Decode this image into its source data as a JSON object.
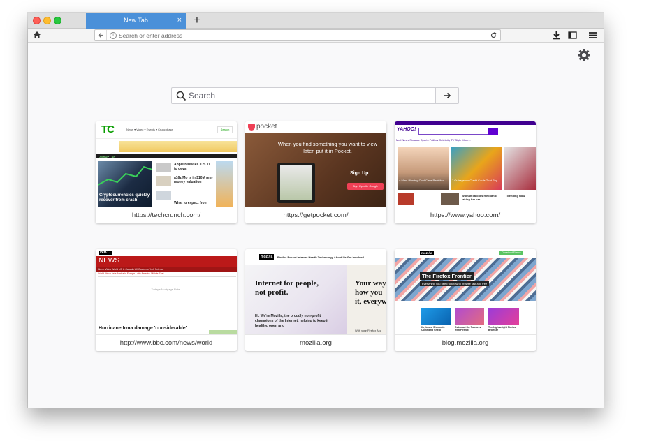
{
  "window": {
    "tab_title": "New Tab",
    "tab_close": "×",
    "new_tab": "+"
  },
  "navbar": {
    "url_placeholder": "Search or enter address"
  },
  "search": {
    "placeholder": "Search"
  },
  "tiles": [
    {
      "label": "https://techcrunch.com/",
      "thumb": {
        "logo": "TC",
        "nav": "News ▾   Video ▾   Events ▾   Crunchbase",
        "search_btn": "Search",
        "banner": "DISRUPT SF",
        "headline1": "Apple releases iOS 11 to devs",
        "headline2": "a16z/Mo Is in $10M pre-money valuation",
        "main_headline": "Cryptocurrencies quickly recover from crash",
        "headline3": "What to expect from"
      }
    },
    {
      "label": "https://getpocket.com/",
      "thumb": {
        "logo": "pocket",
        "headline": "When you find something you want to view later, put it in Pocket.",
        "signup": "Sign Up",
        "google_btn": "Sign Up with Google"
      }
    },
    {
      "label": "https://www.yahoo.com/",
      "thumb": {
        "logo": "YAHOO!",
        "nav": "Mail   News   Finance   Sports   Politics   Celebrity   TV   Style   More...",
        "story1": "A Mind-Blowing Cold Case Revisited",
        "story2": "7 Outrageous Credit Cards That Pay",
        "story3": "Woman catches mechanic taking her car",
        "trending": "Trending Now"
      }
    },
    {
      "label": "http://www.bbc.com/news/world",
      "thumb": {
        "logo": "BBC",
        "news": "NEWS",
        "nav": "Home   Video   World   US & Canada   UK   Business   Tech   Science",
        "subnav": "World   Africa   Asia   Australia   Europe   Latin America   Middle East",
        "mortgage": "Today's Mortgage Rate",
        "headline": "Hurricane Irma damage 'considerable'"
      }
    },
    {
      "label": "mozilla.org",
      "thumb": {
        "logo": "moz://a",
        "nav": "Firefox   Pocket   Internet Health   Technology   About Us   Get Involved",
        "headline": "Internet for people, not profit.",
        "body": "Hi. We're Mozilla, the proudly non-profit champions of the Internet, helping to keep it healthy, open and",
        "right_headline": "Your way how you it, everyw",
        "right_body": "With your Firefox Acc"
      }
    },
    {
      "label": "blog.mozilla.org",
      "thumb": {
        "logo": "moz://a",
        "download": "Download Firefox",
        "title": "The Firefox Frontier",
        "subtitle": "Everything you need to know to browse fast and free",
        "card1": "Keyboard Shortcuts Command Cheat",
        "card2": "Outsmart the Trackers with Firefox",
        "card3": "The Lightweight Firefox Browser"
      }
    }
  ],
  "colors": {
    "tab_active": "#4a90d9",
    "tc_green": "#0a9e01",
    "pocket_red": "#ef4056",
    "yahoo_purple": "#400090",
    "bbc_red": "#bb1919",
    "firefox_green": "#5ac463"
  }
}
